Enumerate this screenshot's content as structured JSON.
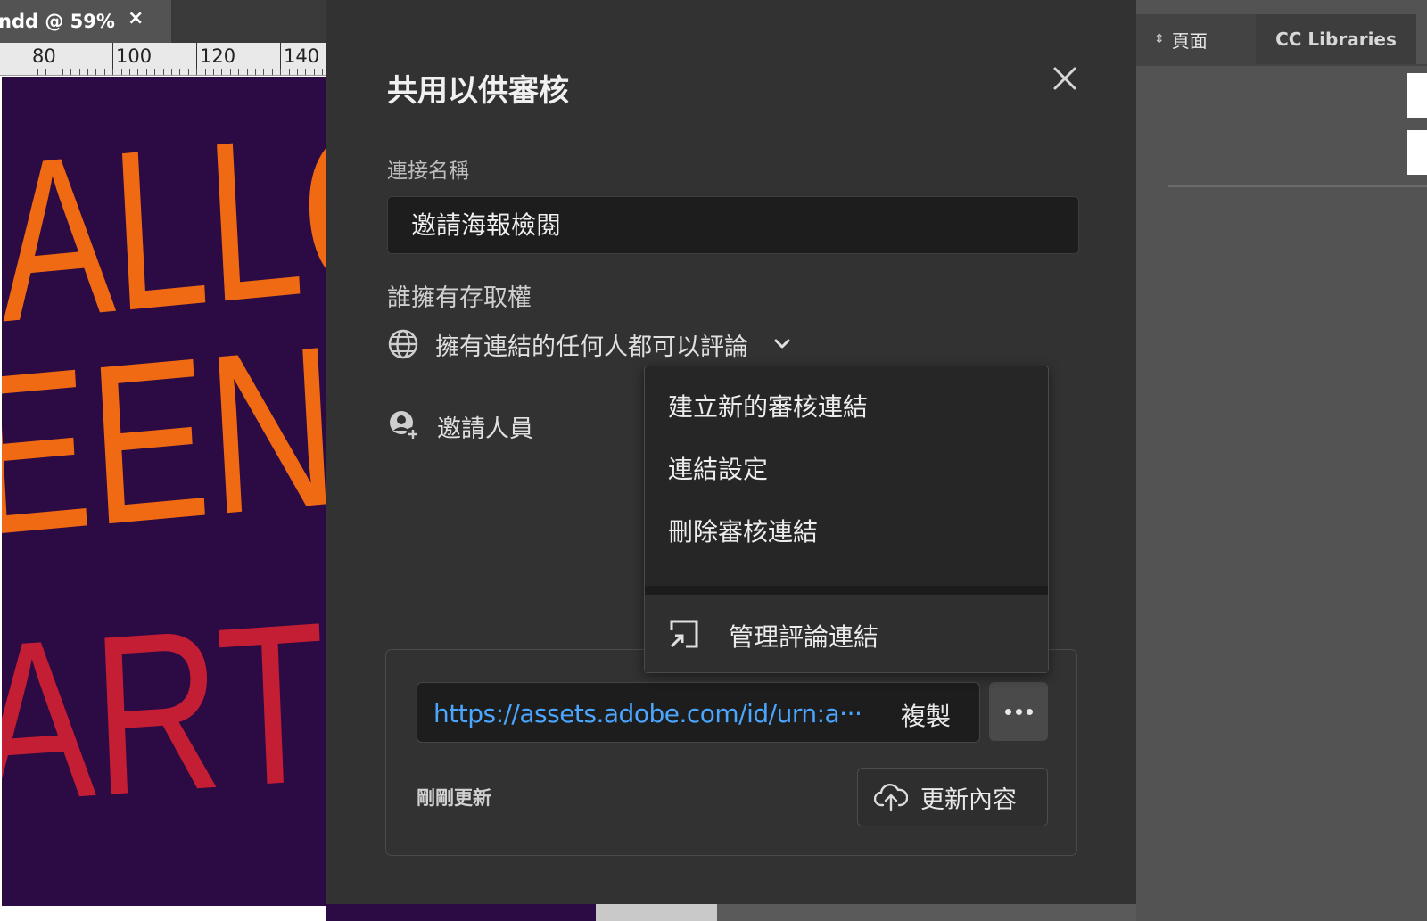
{
  "document_tab": {
    "title": "ndd @ 59%",
    "close_glyph": "×"
  },
  "ruler": {
    "labels": [
      "80",
      "100",
      "120",
      "140"
    ]
  },
  "artwork": {
    "line1": "ALLO",
    "line2": "EEN",
    "line3": "ARTY"
  },
  "dialog": {
    "title": "共用以供審核",
    "close_icon": "close-icon",
    "link_name_label": "連接名稱",
    "link_name_value": "邀請海報檢閱",
    "access_label": "誰擁有存取權",
    "access_value": "擁有連結的任何人都可以評論",
    "invite_label": "邀請人員",
    "url": "https://assets.adobe.com/id/urn:a···",
    "copy_label": "複製",
    "updated_status": "剛剛更新",
    "update_button_label": "更新內容"
  },
  "menu": {
    "items": [
      "建立新的審核連結",
      "連結設定",
      "刪除審核連結"
    ],
    "footer_label": "管理評論連結"
  },
  "right_panel": {
    "tabs": [
      "頁面",
      "CC Libraries"
    ]
  },
  "colors": {
    "link": "#4aa6ff",
    "artboard_bg": "#2c0a43",
    "art_orange": "#ef6a12",
    "art_red": "#c41e35",
    "dialog_bg": "#323232"
  }
}
